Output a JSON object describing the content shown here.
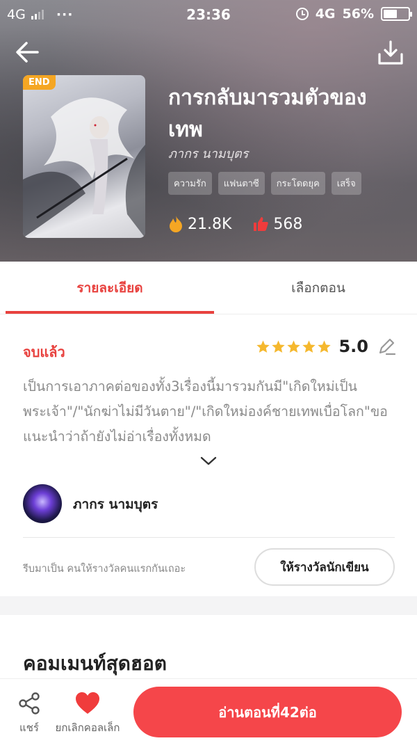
{
  "status_bar": {
    "network_left": "4G",
    "dots": "···",
    "time": "23:36",
    "network_right": "4G",
    "battery": "56%",
    "battery_level": 0.56
  },
  "book": {
    "badge": "END",
    "title": "การกลับมารวมตัวของเทพ",
    "author": "ภากร นามบุตร",
    "tags": [
      "ความรัก",
      "แฟนตาซี",
      "กระโดดยุค",
      "เสร็จ"
    ],
    "views": "21.8K",
    "likes": "568"
  },
  "tabs": {
    "details": "รายละเอียด",
    "chapters": "เลือกตอน"
  },
  "detail": {
    "status": "จบแล้ว",
    "rating": "5.0",
    "stars": 5,
    "synopsis": "เป็นการเอาภาคต่อของทั้ง3เรื่องนี้มารวมกันมี\"เกิดใหม่เป็นพระเจ้า\"/\"นักฆ่าไม่มีวันตาย\"/\"เกิดใหม่องค์ชายเทพเบื่อโลก\"ขอแนะนำว่าถ้ายังไม่อ่าเรื่องทั้งหมด",
    "author_name": "ภากร นามบุตร",
    "reward_prompt": "รีบมาเป็น คนให้รางวัลคนแรกกันเถอะ",
    "reward_button": "ให้รางวัลนักเขียน"
  },
  "comments": {
    "title": "คอมเมนท์สุดฮอต"
  },
  "bottom_bar": {
    "share": "แชร์",
    "uncollect": "ยกเลิกคอลเล็ก",
    "read": "อ่านตอนที่42ต่อ"
  },
  "colors": {
    "accent": "#e8423f",
    "button": "#f5464a",
    "star": "#f5b82e",
    "badge": "#f5a623"
  }
}
